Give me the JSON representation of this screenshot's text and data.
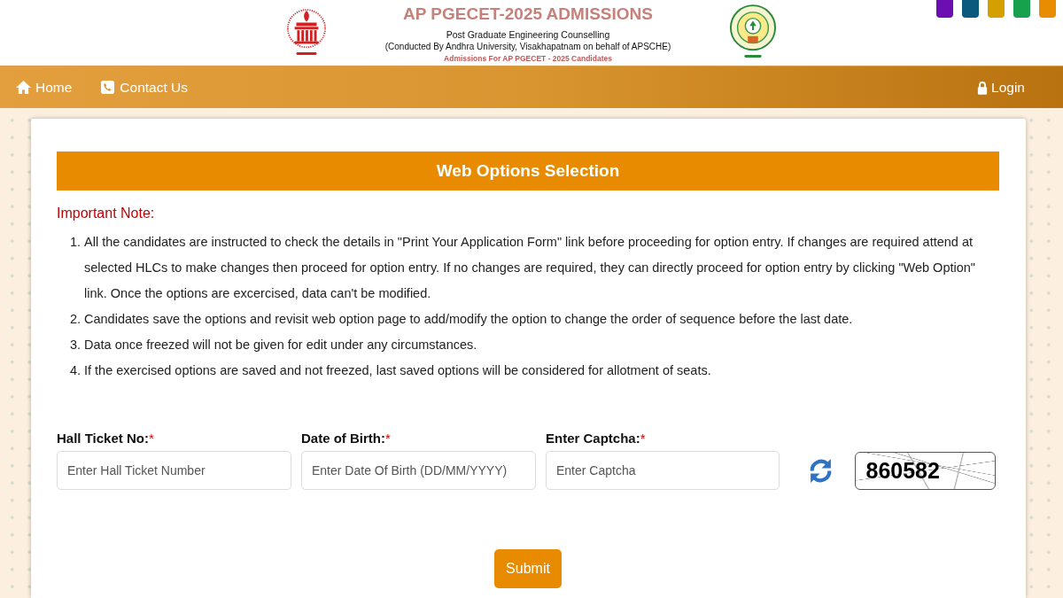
{
  "header": {
    "title": "AP PGECET-2025 ADMISSIONS",
    "subtitle": "Post Graduate Engineering Counselling",
    "conducted_by": "(Conducted By Andhra University, Visakhapatnam on behalf of APSCHE)",
    "tagline": "Admissions For AP PGECET - 2025 Candidates"
  },
  "theme_swatches": [
    {
      "color": "#6b0fb3"
    },
    {
      "color": "#0b5a7e"
    },
    {
      "color": "#d3a000"
    },
    {
      "color": "#17a04e"
    },
    {
      "color": "#e98c00"
    }
  ],
  "nav": {
    "items": [
      {
        "label": "Home",
        "kind": "home"
      },
      {
        "label": "Contact Us",
        "kind": "contact"
      }
    ],
    "login": {
      "label": "Login"
    }
  },
  "form_panel": {
    "title": "Web Options Selection",
    "note_heading": "Important Note:",
    "notes": [
      {
        "number": "1.",
        "text": "All the candidates are instructed to check the details in \"Print Your Application Form\" link before proceeding for option entry. If changes are required attend at selected HLCs to make changes then proceed for option entry. If no changes are required, they can directly proceed for option entry by clicking \"Web Option\" link. Once the options are excercised, data can't be modified."
      },
      {
        "number": "2.",
        "text": "Candidates save the options and revisit web option page to add/modify the option to change the order of sequence before the last date."
      },
      {
        "number": "3.",
        "text": "Data once freezed will not be given for edit under any circumstances."
      },
      {
        "number": "4.",
        "text": "If the exercised options are saved and not freezed, last saved options will be considered for allotment of seats."
      }
    ],
    "fields": [
      {
        "label": "Hall Ticket No:",
        "required_mark": "*",
        "placeholder": "Enter Hall Ticket Number"
      },
      {
        "label": "Date of Birth:",
        "required_mark": "*",
        "placeholder": "Enter Date Of Birth (DD/MM/YYYY)"
      },
      {
        "label": "Enter Captcha:",
        "required_mark": "*",
        "placeholder": "Enter Captcha"
      }
    ],
    "captcha": {
      "code": "860582"
    },
    "submit": "Submit"
  }
}
